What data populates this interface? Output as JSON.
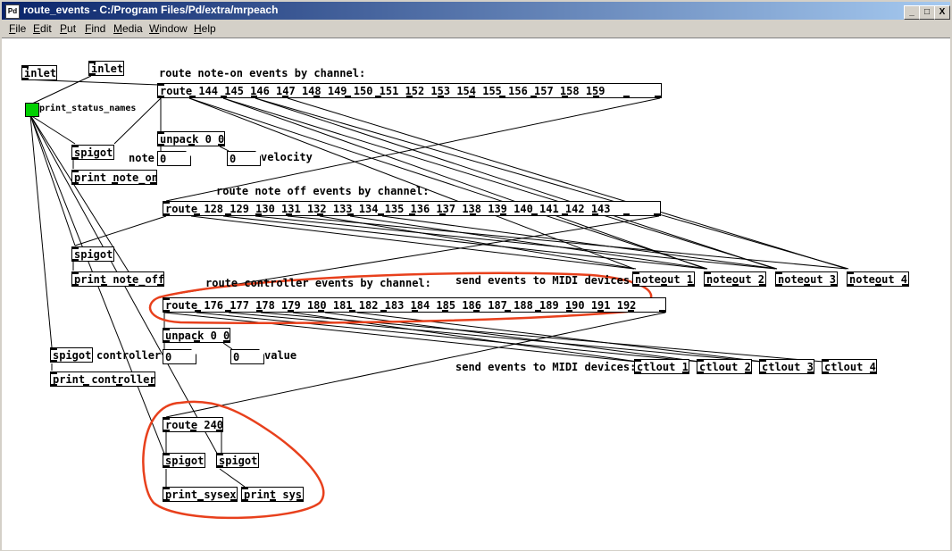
{
  "window": {
    "title": "route_events - C:/Program Files/Pd/extra/mrpeach",
    "icon_text": "Pd",
    "controls": [
      "_",
      "□",
      "X"
    ]
  },
  "menu": [
    "File",
    "Edit",
    "Put",
    "Find",
    "Media",
    "Window",
    "Help"
  ],
  "patch": {
    "boxes": {
      "inlet1": "inlet",
      "inlet2": "inlet",
      "route_on": "route 144 145 146 147 148 149 150 151 152 153 154 155 156 157 158 159",
      "spigot_note_on": "spigot",
      "print_note_on": "print note_on",
      "unpack1": "unpack 0 0",
      "route_off": "route 128 129 130 131 132 133 134 135 136 137 138 139 140 141 142 143",
      "spigot_note_off": "spigot",
      "print_note_off": "print note_off",
      "noteout1": "noteout 1",
      "noteout2": "noteout 2",
      "noteout3": "noteout 3",
      "noteout4": "noteout 4",
      "route_ctl": "route 176 177 178 179 180 181 182 183 184 185 186 187 188 189 190 191 192",
      "unpack2": "unpack 0 0",
      "spigot_ctl": "spigot",
      "print_controller": "print controller",
      "ctlout1": "ctlout 1",
      "ctlout2": "ctlout 2",
      "ctlout3": "ctlout 3",
      "ctlout4": "ctlout 4",
      "route_240": "route 240",
      "spigot_sysex": "spigot",
      "spigot_sys": "spigot",
      "print_sysex": "print sysex",
      "print_sys": "print sys"
    },
    "numbers": {
      "note": "0",
      "velocity": "0",
      "controller": "0",
      "value": "0"
    },
    "labels": {
      "route_on_comment": "route note-on events by channel:",
      "route_off_comment": "route note off events by channel:",
      "route_ctl_comment": "route controller events by channel:",
      "send_midi_1": "send events to MIDI devices:",
      "send_midi_2": "send events to MIDI devices:",
      "note": "note",
      "velocity": "velocity",
      "controller": "controller",
      "value": "value",
      "print_status_names": "print_status_names"
    },
    "colors": {
      "bang": "#00d000",
      "annotation": "#e8401c"
    }
  }
}
